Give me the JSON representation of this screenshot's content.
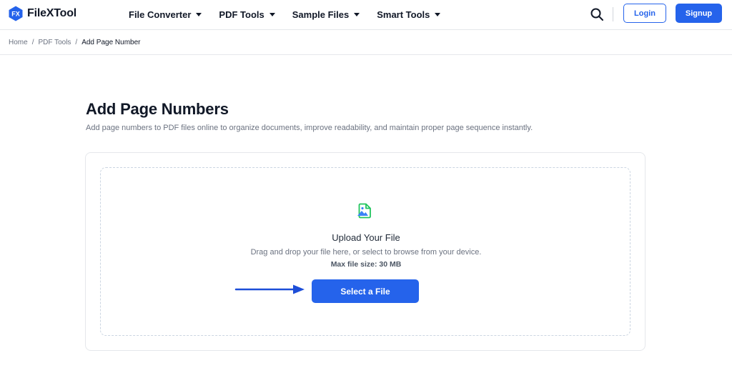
{
  "brand": {
    "name": "FileXTool",
    "mark_text": "FX",
    "primary_color": "#2563eb"
  },
  "nav": {
    "items": [
      {
        "label": "File Converter"
      },
      {
        "label": "PDF Tools"
      },
      {
        "label": "Sample Files"
      },
      {
        "label": "Smart Tools"
      }
    ]
  },
  "header_actions": {
    "search_icon": "search-icon",
    "login_label": "Login",
    "signup_label": "Signup"
  },
  "breadcrumb": {
    "items": [
      "Home",
      "PDF Tools",
      "Add Page Number"
    ],
    "separator": "/"
  },
  "page": {
    "title": "Add Page Numbers",
    "subtitle": "Add page numbers to PDF files online to organize documents, improve readability, and maintain proper page sequence instantly."
  },
  "upload": {
    "icon": "file-image-icon",
    "title": "Upload Your File",
    "description": "Drag and drop your file here, or select to browse from your device.",
    "max_size": "Max file size: 30 MB",
    "button_label": "Select a File"
  }
}
